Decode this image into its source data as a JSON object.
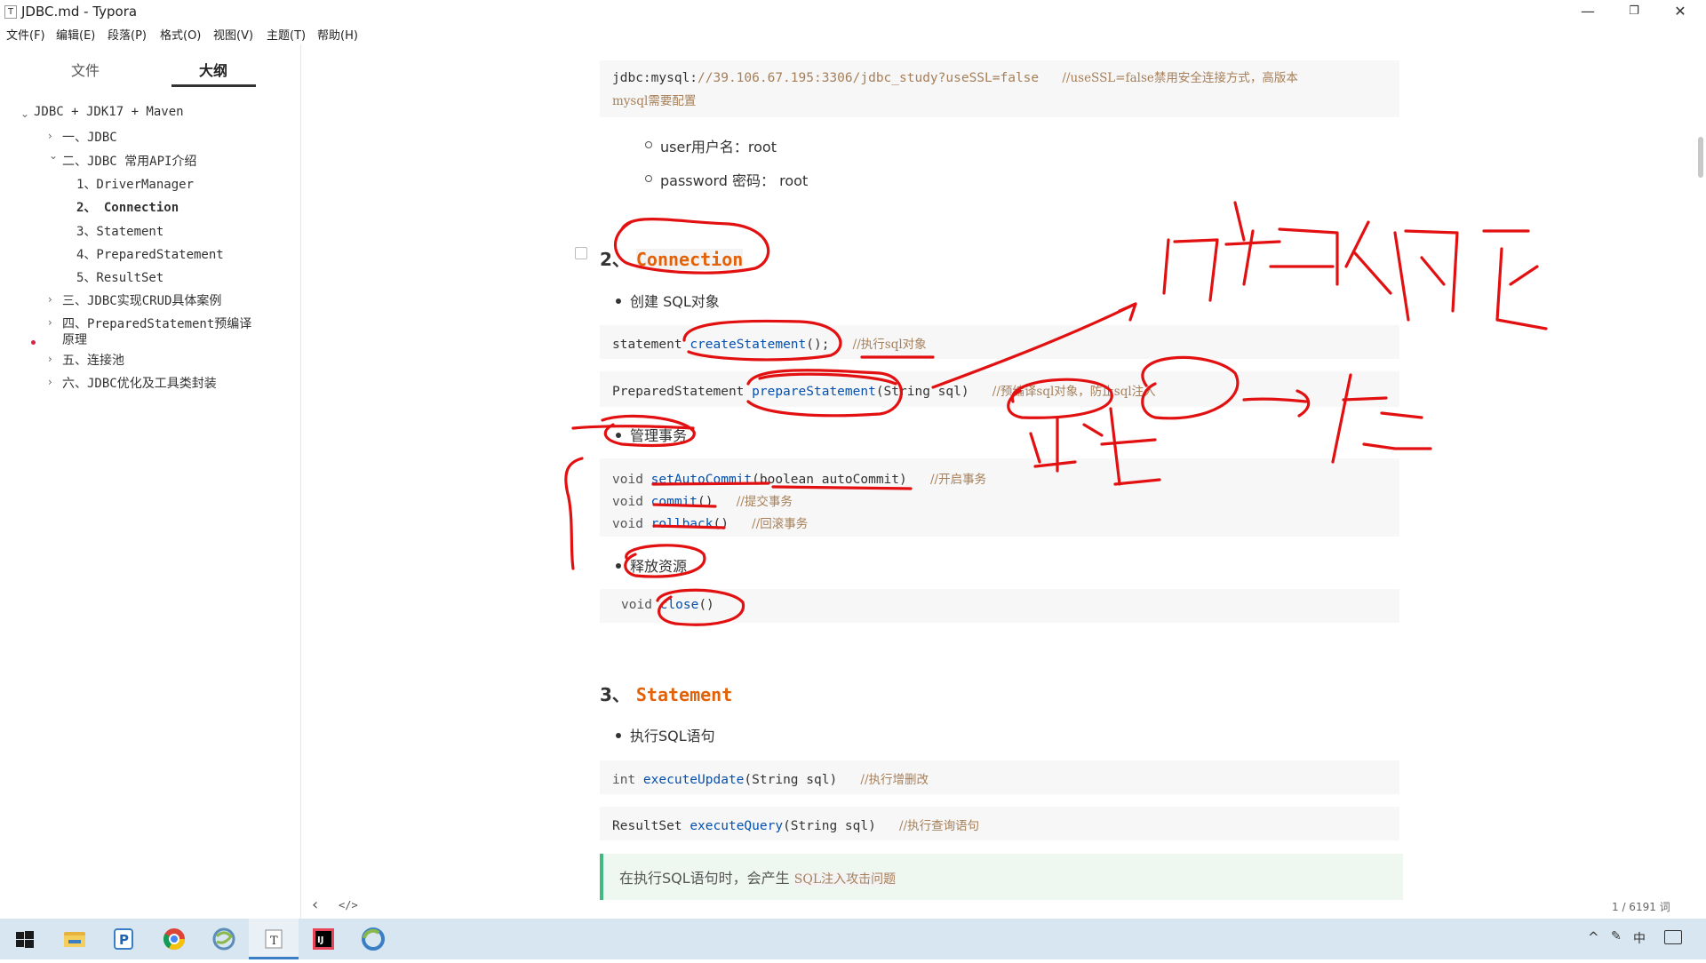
{
  "window": {
    "title": "JDBC.md - Typora",
    "minimize": "—",
    "maximize": "❐",
    "close": "✕"
  },
  "menu": [
    "文件(F)",
    "编辑(E)",
    "段落(P)",
    "格式(O)",
    "视图(V)",
    "主题(T)",
    "帮助(H)"
  ],
  "sidebar": {
    "tabs": [
      "文件",
      "大纲"
    ],
    "outline": [
      "JDBC + JDK17 + Maven",
      "一、JDBC",
      "二、JDBC 常用API介绍",
      "1、DriverManager",
      "2、 Connection",
      "3、Statement",
      "4、PreparedStatement",
      "5、ResultSet",
      "三、JDBC实现CRUD具体案例",
      "四、PreparedStatement预编译",
      "原理",
      "五、连接池",
      "六、JDBC优化及工具类封装"
    ]
  },
  "doc": {
    "url_code": {
      "pre": "jdbc:mysql:",
      "str": "//39.106.67.195:3306/jdbc_study?useSSL=false",
      "comment": "//useSSL=false禁用安全连接方式，高版本",
      "line2": "mysql需要配置"
    },
    "user": "user用户名：root",
    "password": "password 密码：  root",
    "h_connection": {
      "num": "2、",
      "code": "Connection"
    },
    "create_sql": "创建 SQL对象",
    "code_statement": {
      "a": "statement ",
      "fn": "createStatement",
      "paren": "();",
      "comment": "//执行sql对象"
    },
    "code_prepared": {
      "a": "PreparedStatement ",
      "fn": "prepareStatement",
      "args": "(String sql)",
      "comment": "//预编译sql对象，防止sql注入"
    },
    "tx_title": "管理事务",
    "tx_lines": [
      {
        "kw": "void ",
        "fn": "setAutoCommit",
        "args": "(boolean autoCommit)",
        "comment": "//开启事务"
      },
      {
        "kw": "void ",
        "fn": "commit",
        "args": "()",
        "comment": "//提交事务"
      },
      {
        "kw": "void ",
        "fn": "rollback",
        "args": "()",
        "comment": "//回滚事务"
      }
    ],
    "release": "释放资源",
    "close_code": {
      "kw": "void ",
      "fn": "close",
      "args": "()"
    },
    "h_statement": {
      "num": "3、",
      "code": "Statement"
    },
    "exec_sql": "执行SQL语句",
    "code_update": {
      "kw": "int ",
      "fn": "executeUpdate",
      "args": "(String sql)",
      "comment": "//执行增删改"
    },
    "code_query": {
      "kw": "ResultSet ",
      "fn": "executeQuery",
      "args": "(String sql)",
      "comment": "//执行查询语句"
    },
    "tip": {
      "text": "在执行SQL语句时，会产生 ",
      "code": "SQL注入攻击问题"
    }
  },
  "status": {
    "word_count": "1 / 6191 词",
    "back": "‹",
    "source": "</>"
  },
  "taskbar": {
    "apps": [
      "start-icon",
      "file-explorer-icon",
      "p-app-icon",
      "chrome-icon",
      "snake-app-icon",
      "typora-icon",
      "intellij-icon",
      "browser-icon"
    ],
    "tray": {
      "caret": "^",
      "ime": "中"
    }
  }
}
